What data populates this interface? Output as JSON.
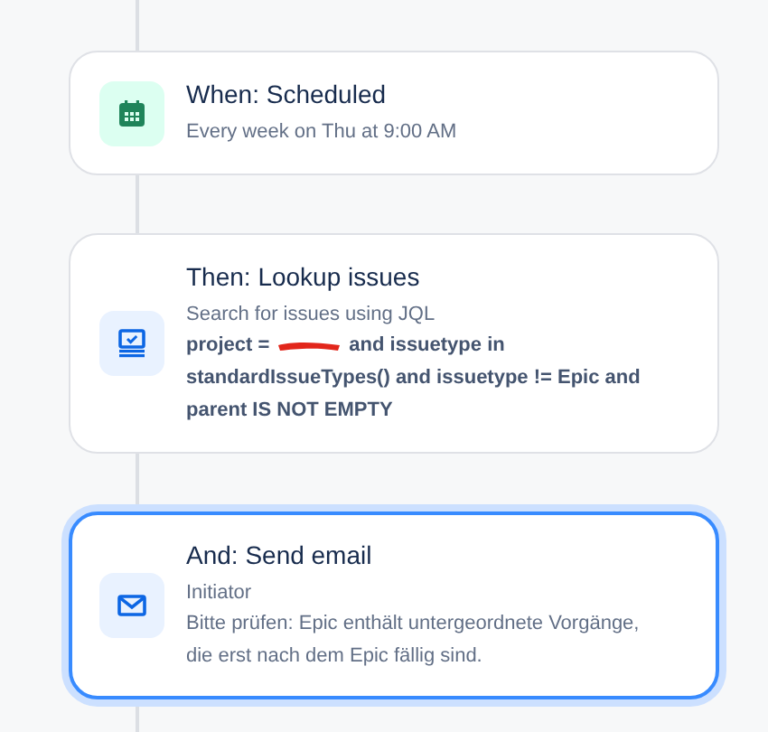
{
  "steps": [
    {
      "kind": "schedule",
      "title": "When: Scheduled",
      "subtitle": "Every week on Thu at 9:00 AM",
      "selected": false
    },
    {
      "kind": "lookup",
      "title": "Then: Lookup issues",
      "subtitle": "Search for issues using JQL",
      "query_prefix": "project =",
      "redacted": true,
      "query_rest": "and issuetype in",
      "query_continuation": "standardIssueTypes() and issuetype != Epic and parent IS NOT EMPTY",
      "selected": false
    },
    {
      "kind": "email",
      "title": "And: Send email",
      "subtitle": "Initiator",
      "message": "Bitte prüfen: Epic enthält untergeordnete Vorgänge, die erst nach dem Epic fällig sind.",
      "selected": true
    }
  ]
}
